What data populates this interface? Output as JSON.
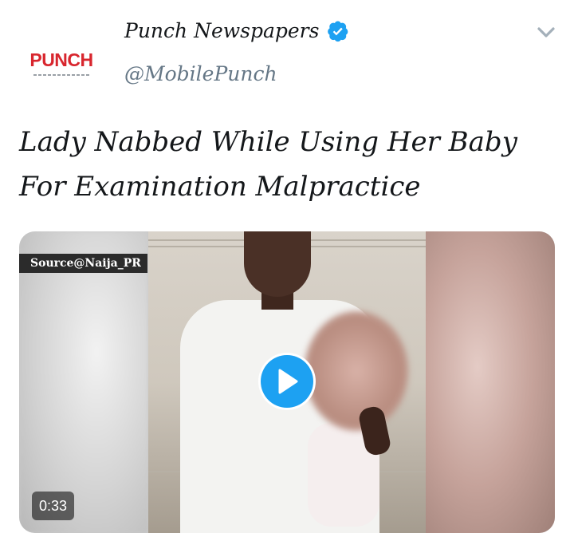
{
  "tweet": {
    "author": {
      "display_name": "Punch Newspapers",
      "handle": "@MobilePunch",
      "avatar_logo_text": "PUNCH",
      "verified": true
    },
    "text": "Lady Nabbed While Using Her Baby For Examination Malpractice",
    "media": {
      "type": "video",
      "source_watermark": "Source@Naija_PR",
      "duration": "0:33"
    }
  },
  "colors": {
    "accent_blue": "#1da1f2",
    "logo_red": "#d8262e",
    "secondary_text": "#657786"
  },
  "icons": {
    "verified": "verified-badge-icon",
    "menu": "chevron-down-icon",
    "play": "play-icon"
  }
}
